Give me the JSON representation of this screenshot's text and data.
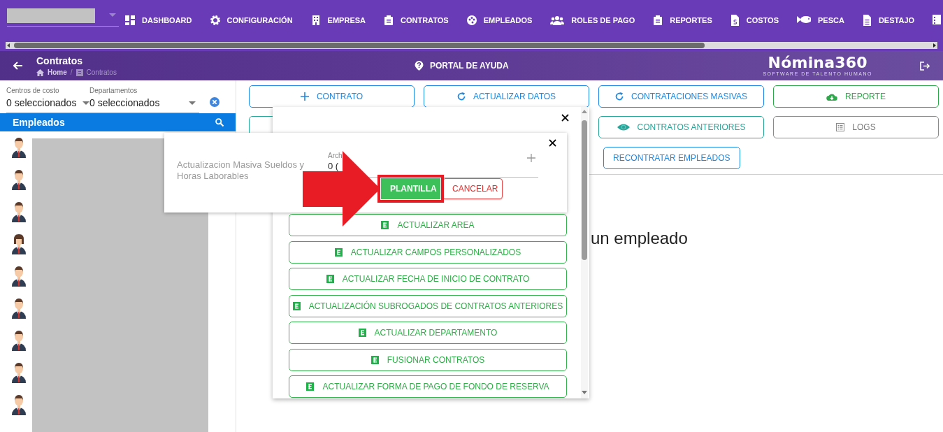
{
  "top_nav": {
    "items": [
      {
        "label": "DASHBOARD"
      },
      {
        "label": "CONFIGURACIÓN"
      },
      {
        "label": "EMPRESA"
      },
      {
        "label": "CONTRATOS"
      },
      {
        "label": "EMPLEADOS"
      },
      {
        "label": "ROLES DE PAGO"
      },
      {
        "label": "REPORTES"
      },
      {
        "label": "COSTOS"
      },
      {
        "label": "PESCA"
      },
      {
        "label": "DESTAJO"
      }
    ]
  },
  "header": {
    "title": "Contratos",
    "breadcrumb": {
      "items": [
        "Home",
        "Contratos"
      ],
      "separator": "/"
    },
    "help_link": "PORTAL DE AYUDA",
    "logo": {
      "name": "Nómina360",
      "tagline": "SOFTWARE DE TALENTO HUMANO"
    }
  },
  "filters": [
    {
      "label": "Centros de costo",
      "value": "0 seleccionados"
    },
    {
      "label": "Departamentos",
      "value": "0 seleccionados"
    }
  ],
  "employees_panel": {
    "title": "Empleados",
    "rows": [
      {
        "kind": "male"
      },
      {
        "kind": "male"
      },
      {
        "kind": "male"
      },
      {
        "kind": "female"
      },
      {
        "kind": "male"
      },
      {
        "kind": "male"
      },
      {
        "kind": "male"
      },
      {
        "kind": "male"
      },
      {
        "kind": "male"
      }
    ]
  },
  "actions": [
    {
      "label": "CONTRATO",
      "color": "#1e88e5"
    },
    {
      "label": "ACTUALIZAR DATOS",
      "color": "#1e88e5"
    },
    {
      "label": "CONTRATACIONES MASIVAS",
      "color": "#1e88e5"
    },
    {
      "label": "REPORTE",
      "color": "#2ea84a"
    },
    {
      "color": "#26a69a"
    },
    {
      "label": "CONTRATOS ANTERIORES",
      "color": "#26a69a"
    },
    {
      "label": "LOGS",
      "color": "#8a8a8a"
    },
    {
      "label": "RECONTRATAR EMPLEADOS",
      "color": "#1e88e5"
    }
  ],
  "empty_message": "un empleado",
  "mass_update_menu": {
    "items": [
      "ACTUALIZAR AREA",
      "ACTUALIZAR CAMPOS PERSONALIZADOS",
      "ACTUALIZAR FECHA DE INICIO DE CONTRATO",
      "ACTUALIZACIÓN SUBROGADOS DE CONTRATOS ANTERIORES",
      "ACTUALIZAR DEPARTAMENTO",
      "FUSIONAR CONTRATOS",
      "ACTUALIZAR FORMA DE PAGO DE FONDO DE RESERVA"
    ]
  },
  "upload_dialog": {
    "title": "Actualizacion Masiva Sueldos y Horas Laborables",
    "field": {
      "label": "Arch",
      "value": "0 ("
    },
    "buttons": [
      {
        "label": "PLANTILLA",
        "kind": "primary",
        "highlighted": true
      },
      {
        "label": "CANCELAR",
        "kind": "cancel",
        "highlighted": false
      }
    ]
  },
  "annotation": {
    "kind": "arrow"
  }
}
